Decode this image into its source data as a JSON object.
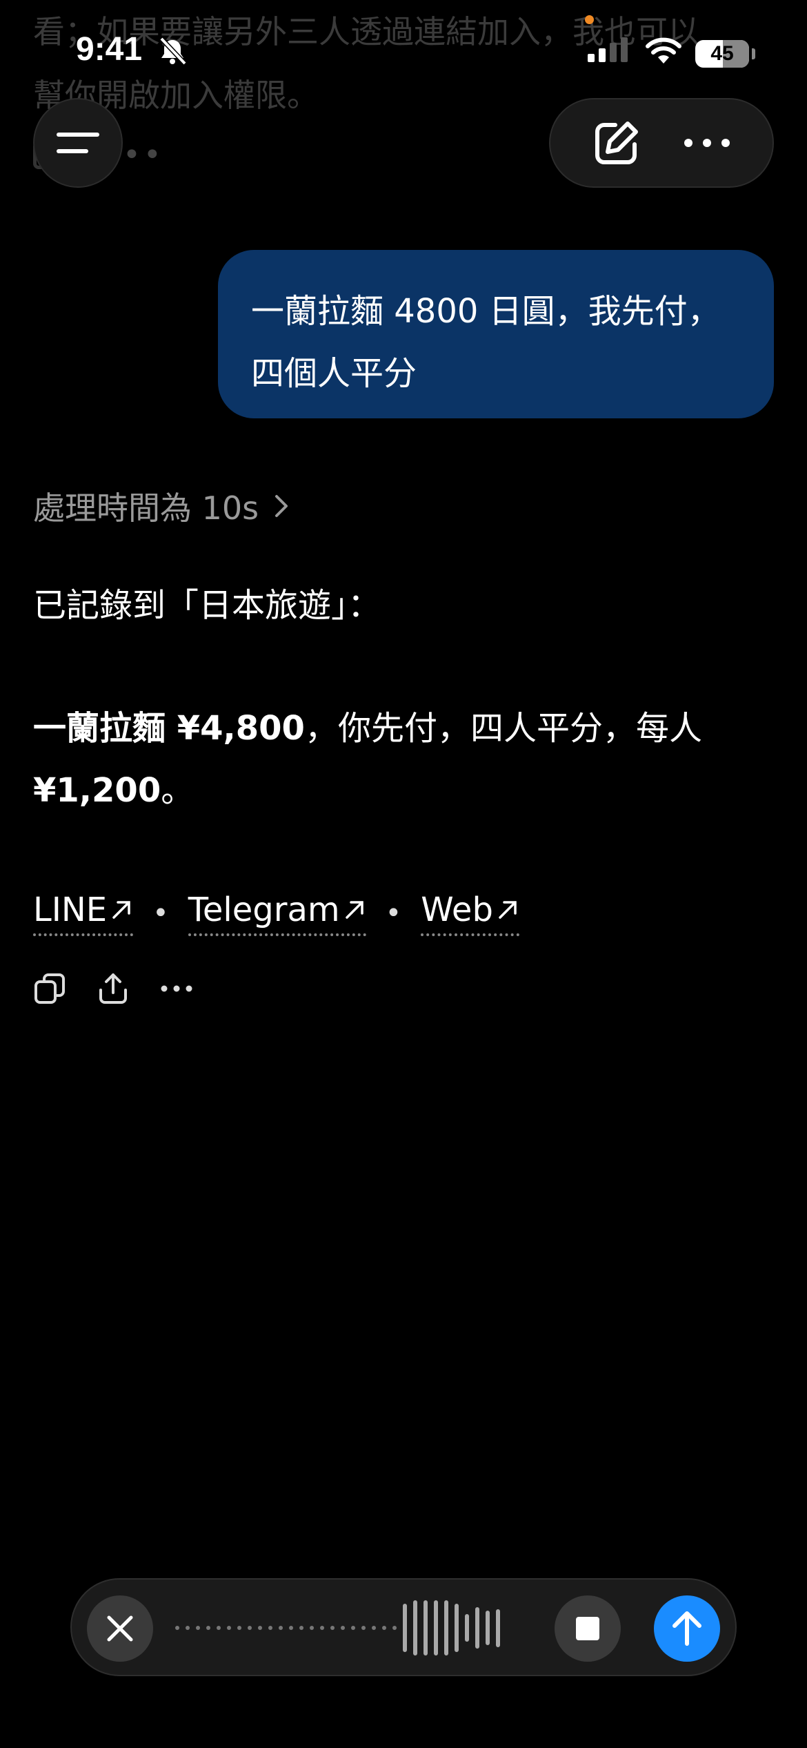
{
  "previous_message": {
    "line1": "看；如果要讓另外三人透過連結加入，我也可以",
    "line2": "幫你開啟加入權限。"
  },
  "status_bar": {
    "time": "9:41",
    "battery": "45",
    "icons": [
      "bell-slash-icon",
      "cellular-signal-icon",
      "wifi-icon",
      "battery-icon"
    ]
  },
  "header": {
    "icons": [
      "menu-icon",
      "new-chat-icon",
      "more-icon"
    ]
  },
  "user_message": {
    "text": "一蘭拉麵 4800 日圓，我先付，四個人平分"
  },
  "assistant": {
    "processing": "處理時間為 10s",
    "recorded_to": "已記錄到「日本旅遊」：",
    "item_bold": "一蘭拉麵 ¥4,800",
    "item_rest": "，你先付，四人平分，每人",
    "per_person_bold": "¥1,200",
    "per_person_end": "。",
    "links": [
      {
        "label": "LINE"
      },
      {
        "label": "Telegram"
      },
      {
        "label": "Web"
      }
    ],
    "separator": "•",
    "action_icons": [
      "copy-icon",
      "share-icon",
      "more-icon"
    ]
  },
  "composer": {
    "icons": [
      "close-icon",
      "waveform-icon",
      "stop-icon",
      "send-arrow-icon"
    ],
    "colors": {
      "send": "#1a8cff",
      "bubble": "#0b3466"
    }
  }
}
